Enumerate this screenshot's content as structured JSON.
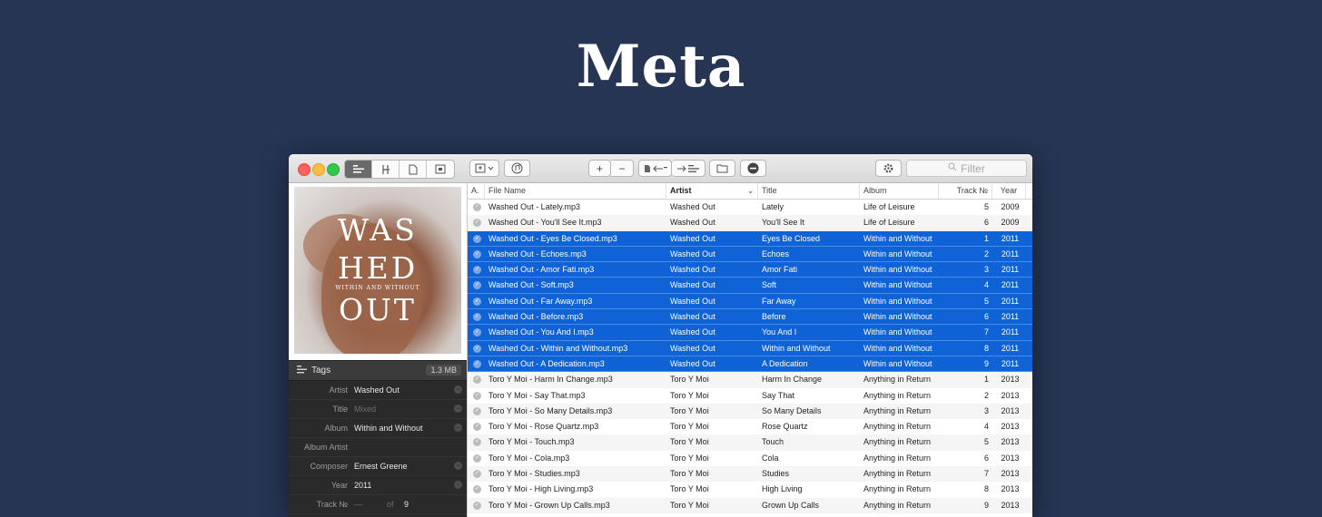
{
  "hero": {
    "title": "Meta"
  },
  "toolbar": {
    "view_icons": [
      "tags-view-icon",
      "music-icon",
      "document-icon",
      "artwork-icon"
    ],
    "plus": "+",
    "minus": "−",
    "filter_placeholder": "Filter"
  },
  "artwork": {
    "line1": "WAS",
    "line2": "HED",
    "line3": "OUT",
    "subtitle": "WITHIN AND WITHOUT"
  },
  "tags": {
    "header": "Tags",
    "size": "1.3 MB",
    "fields": [
      {
        "key": "Artist",
        "value": "Washed Out",
        "placeholder": false
      },
      {
        "key": "Title",
        "value": "Mixed",
        "placeholder": true
      },
      {
        "key": "Album",
        "value": "Within and Without",
        "placeholder": false
      },
      {
        "key": "Album Artist",
        "value": "",
        "placeholder": false
      },
      {
        "key": "Composer",
        "value": "Ernest Greene",
        "placeholder": false
      },
      {
        "key": "Year",
        "value": "2011",
        "placeholder": false
      },
      {
        "key": "Track №",
        "value": "—",
        "of": "of",
        "total": "9",
        "placeholder": true
      }
    ]
  },
  "table": {
    "columns": [
      "A.",
      "File Name",
      "Artist",
      "Title",
      "Album",
      "Track №",
      "Year"
    ],
    "rows": [
      {
        "file": "Washed Out - Lately.mp3",
        "artist": "Washed Out",
        "title": "Lately",
        "album": "Life of Leisure",
        "track": "5",
        "year": "2009",
        "selected": false
      },
      {
        "file": "Washed Out - You'll See It.mp3",
        "artist": "Washed Out",
        "title": "You'll See It",
        "album": "Life of Leisure",
        "track": "6",
        "year": "2009",
        "selected": false
      },
      {
        "file": "Washed Out - Eyes Be Closed.mp3",
        "artist": "Washed Out",
        "title": "Eyes Be Closed",
        "album": "Within and Without",
        "track": "1",
        "year": "2011",
        "selected": true
      },
      {
        "file": "Washed Out - Echoes.mp3",
        "artist": "Washed Out",
        "title": "Echoes",
        "album": "Within and Without",
        "track": "2",
        "year": "2011",
        "selected": true
      },
      {
        "file": "Washed Out - Amor Fati.mp3",
        "artist": "Washed Out",
        "title": "Amor Fati",
        "album": "Within and Without",
        "track": "3",
        "year": "2011",
        "selected": true
      },
      {
        "file": "Washed Out - Soft.mp3",
        "artist": "Washed Out",
        "title": "Soft",
        "album": "Within and Without",
        "track": "4",
        "year": "2011",
        "selected": true
      },
      {
        "file": "Washed Out - Far Away.mp3",
        "artist": "Washed Out",
        "title": "Far Away",
        "album": "Within and Without",
        "track": "5",
        "year": "2011",
        "selected": true
      },
      {
        "file": "Washed Out - Before.mp3",
        "artist": "Washed Out",
        "title": "Before",
        "album": "Within and Without",
        "track": "6",
        "year": "2011",
        "selected": true
      },
      {
        "file": "Washed Out - You And I.mp3",
        "artist": "Washed Out",
        "title": "You And I",
        "album": "Within and Without",
        "track": "7",
        "year": "2011",
        "selected": true
      },
      {
        "file": "Washed Out - Within and Without.mp3",
        "artist": "Washed Out",
        "title": "Within and Without",
        "album": "Within and Without",
        "track": "8",
        "year": "2011",
        "selected": true
      },
      {
        "file": "Washed Out - A Dedication.mp3",
        "artist": "Washed Out",
        "title": "A Dedication",
        "album": "Within and Without",
        "track": "9",
        "year": "2011",
        "selected": true
      },
      {
        "file": "Toro Y Moi - Harm In Change.mp3",
        "artist": "Toro Y Moi",
        "title": "Harm In Change",
        "album": "Anything in Return",
        "track": "1",
        "year": "2013",
        "selected": false
      },
      {
        "file": "Toro Y Moi - Say That.mp3",
        "artist": "Toro Y Moi",
        "title": "Say That",
        "album": "Anything in Return",
        "track": "2",
        "year": "2013",
        "selected": false
      },
      {
        "file": "Toro Y Moi - So Many Details.mp3",
        "artist": "Toro Y Moi",
        "title": "So Many Details",
        "album": "Anything in Return",
        "track": "3",
        "year": "2013",
        "selected": false
      },
      {
        "file": "Toro Y Moi - Rose Quartz.mp3",
        "artist": "Toro Y Moi",
        "title": "Rose Quartz",
        "album": "Anything in Return",
        "track": "4",
        "year": "2013",
        "selected": false
      },
      {
        "file": "Toro Y Moi - Touch.mp3",
        "artist": "Toro Y Moi",
        "title": "Touch",
        "album": "Anything in Return",
        "track": "5",
        "year": "2013",
        "selected": false
      },
      {
        "file": "Toro Y Moi - Cola.mp3",
        "artist": "Toro Y Moi",
        "title": "Cola",
        "album": "Anything in Return",
        "track": "6",
        "year": "2013",
        "selected": false
      },
      {
        "file": "Toro Y Moi - Studies.mp3",
        "artist": "Toro Y Moi",
        "title": "Studies",
        "album": "Anything in Return",
        "track": "7",
        "year": "2013",
        "selected": false
      },
      {
        "file": "Toro Y Moi - High Living.mp3",
        "artist": "Toro Y Moi",
        "title": "High Living",
        "album": "Anything in Return",
        "track": "8",
        "year": "2013",
        "selected": false
      },
      {
        "file": "Toro Y Moi - Grown Up Calls.mp3",
        "artist": "Toro Y Moi",
        "title": "Grown Up Calls",
        "album": "Anything in Return",
        "track": "9",
        "year": "2013",
        "selected": false
      }
    ]
  },
  "colors": {
    "background": "#253553",
    "selection": "#0f63d6"
  }
}
